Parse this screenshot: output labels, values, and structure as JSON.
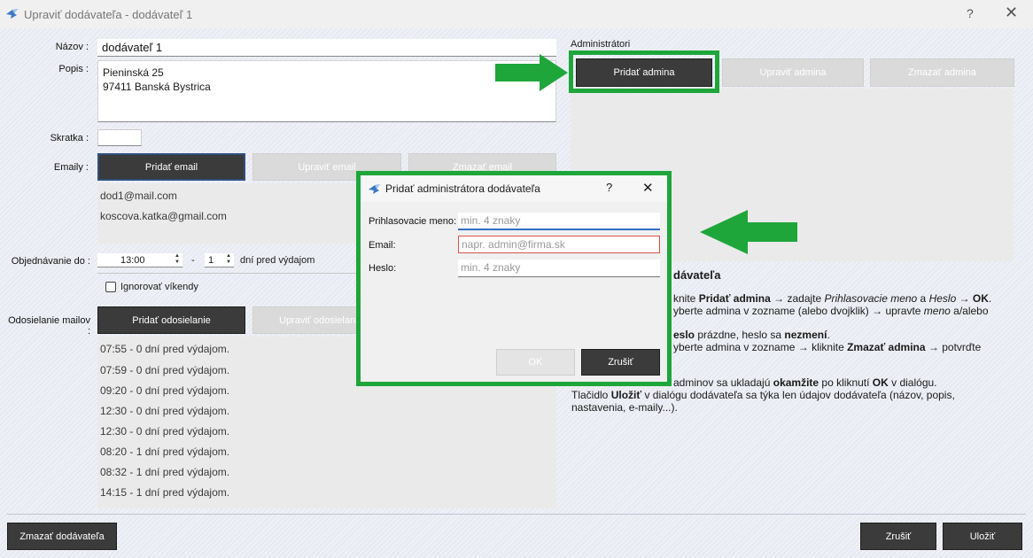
{
  "window": {
    "title": "Upraviť dodávateľa - dodávateľ 1",
    "help": "?",
    "close": "✕"
  },
  "form": {
    "name_label": "Názov :",
    "name_value": "dodávateľ 1",
    "desc_label": "Popis :",
    "desc_line1": "Pieninská 25",
    "desc_line2": "97411  Banská Bystrica",
    "abbr_label": "Skratka :",
    "abbr_value": "",
    "emails_label": "Emaily :",
    "email_add": "Pridať email",
    "email_edit": "Upraviť email",
    "email_delete": "Zmazať email",
    "emails": [
      "dod1@mail.com",
      "koscova.katka@gmail.com"
    ],
    "order_label": "Objednávanie do :",
    "order_time": "13:00",
    "order_dash": "-",
    "order_days": "1",
    "order_suffix": "dní pred výdajom",
    "ignore_weekends": "Ignorovať víkendy",
    "sending_label": "Odosielanie mailov :",
    "sender_add": "Pridať odosielanie",
    "sender_edit": "Upraviť odosielanie",
    "sendings": [
      "07:55 - 0 dní pred výdajom.",
      "07:59 - 0 dní pred výdajom.",
      "09:20 - 0 dní pred výdajom.",
      "12:30 - 0 dní pred výdajom.",
      "12:30 - 0 dní pred výdajom.",
      "08:20 - 1 dní pred výdajom.",
      "08:32 - 1 dní pred výdajom.",
      "14:15 - 1 dní pred výdajom."
    ]
  },
  "admins": {
    "title": "Administrátori",
    "add": "Pridať admina",
    "edit": "Upraviť admina",
    "delete": "Zmazať admina",
    "help_heading": "dávateľa",
    "help_l1_a": "knite ",
    "help_l1_b": "Pridať admina",
    "help_l1_c": " → zadajte ",
    "help_l1_d": "Prihlasovacie meno",
    "help_l1_e": " a ",
    "help_l1_f": "Heslo",
    "help_l1_g": " → ",
    "help_l1_h": "OK",
    "help_l1_i": ".",
    "help_l2_a": "yberte admina v zozname (alebo dvojklik) → upravte ",
    "help_l2_b": "meno",
    "help_l2_c": " a/alebo",
    "help_l3_a": "eslo",
    "help_l3_b": " prázdne, heslo sa ",
    "help_l3_c": "nezmení",
    "help_l3_d": ".",
    "help_l4_a": "yberte admina v zozname → kliknite ",
    "help_l4_b": "Zmazať admina",
    "help_l4_c": " → potvrďte",
    "help_l5_a": "adminov sa ukladajú ",
    "help_l5_b": "okamžite",
    "help_l5_c": " po kliknutí ",
    "help_l5_d": "OK",
    "help_l5_e": " v dialógu.",
    "help_l6_a": "Tlačidlo ",
    "help_l6_b": "Uložiť",
    "help_l6_c": " v dialógu dodávateľa sa týka len údajov dodávateľa (názov, popis,",
    "help_l7": "nastavenia, e-maily...)."
  },
  "footer": {
    "delete_supplier": "Zmazať dodávateľa",
    "cancel": "Zrušiť",
    "save": "Uložiť"
  },
  "dialog": {
    "title": "Pridať administrátora dodávateľa",
    "help": "?",
    "close": "✕",
    "login_label": "Prihlasovacie meno:",
    "login_placeholder": "min. 4 znaky",
    "email_label": "Email:",
    "email_placeholder": "napr. admin@firma.sk",
    "password_label": "Heslo:",
    "password_placeholder": "min. 4 znaky",
    "ok": "OK",
    "cancel": "Zrušiť"
  },
  "colors": {
    "highlight": "#1ea63b",
    "dark_button": "#3b3b3b",
    "disabled_button": "#dadada",
    "email_error_border": "#d9534f"
  }
}
